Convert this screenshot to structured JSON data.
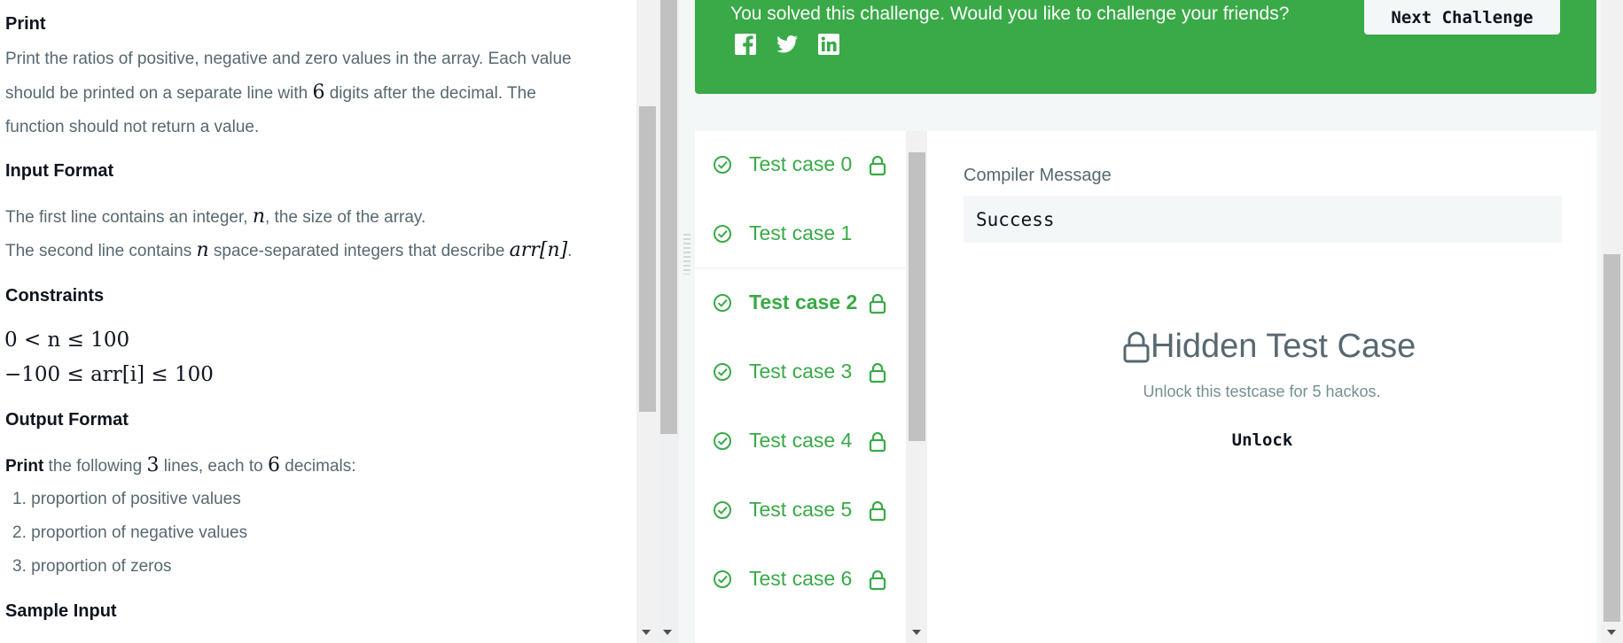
{
  "problem": {
    "print_title": "Print",
    "print_para": [
      "Print the ratios of positive, negative and zero values in the array. Each value",
      "should be printed on a separate line with ",
      "6",
      " digits after the decimal. The",
      "function should not return a value."
    ],
    "input_title": "Input Format",
    "input_line1_a": "The first line contains an integer, ",
    "input_line1_var": "n",
    "input_line1_b": ", the size of the array.",
    "input_line2_a": "The second line contains ",
    "input_line2_var": "n",
    "input_line2_b": " space-separated integers that describe ",
    "input_line2_arr": "arr[n]",
    "input_line2_c": ".",
    "constraints_title": "Constraints",
    "constraint1": "0 < n ≤ 100",
    "constraint2": "−100 ≤ arr[i] ≤ 100",
    "output_title": "Output Format",
    "output_print": "Print",
    "output_a": " the following ",
    "output_3": "3",
    "output_b": " lines, each to ",
    "output_6": "6",
    "output_c": " decimals:",
    "output_items": [
      "1. proportion of positive values",
      "2. proportion of negative values",
      "3. proportion of zeros"
    ],
    "sample_title": "Sample Input"
  },
  "banner": {
    "message": "You solved this challenge. Would you like to challenge your friends?",
    "next_button": "Next Challenge",
    "social_icons": [
      "facebook-icon",
      "twitter-icon",
      "linkedin-icon"
    ],
    "color": "#39aa47"
  },
  "test_cases": [
    {
      "label": "Test case 0",
      "locked": true,
      "active": false
    },
    {
      "label": "Test case 1",
      "locked": false,
      "active": false
    },
    {
      "label": "Test case 2",
      "locked": true,
      "active": true
    },
    {
      "label": "Test case 3",
      "locked": true,
      "active": false
    },
    {
      "label": "Test case 4",
      "locked": true,
      "active": false
    },
    {
      "label": "Test case 5",
      "locked": true,
      "active": false
    },
    {
      "label": "Test case 6",
      "locked": true,
      "active": false
    }
  ],
  "detail": {
    "compiler_label": "Compiler Message",
    "compiler_value": "Success",
    "hidden_title": "Hidden Test Case",
    "hidden_sub": "Unlock this testcase for 5 hackos.",
    "unlock_label": "Unlock"
  },
  "colors": {
    "accent": "#39aa47",
    "text": "#576871",
    "heading": "#0e141e"
  }
}
